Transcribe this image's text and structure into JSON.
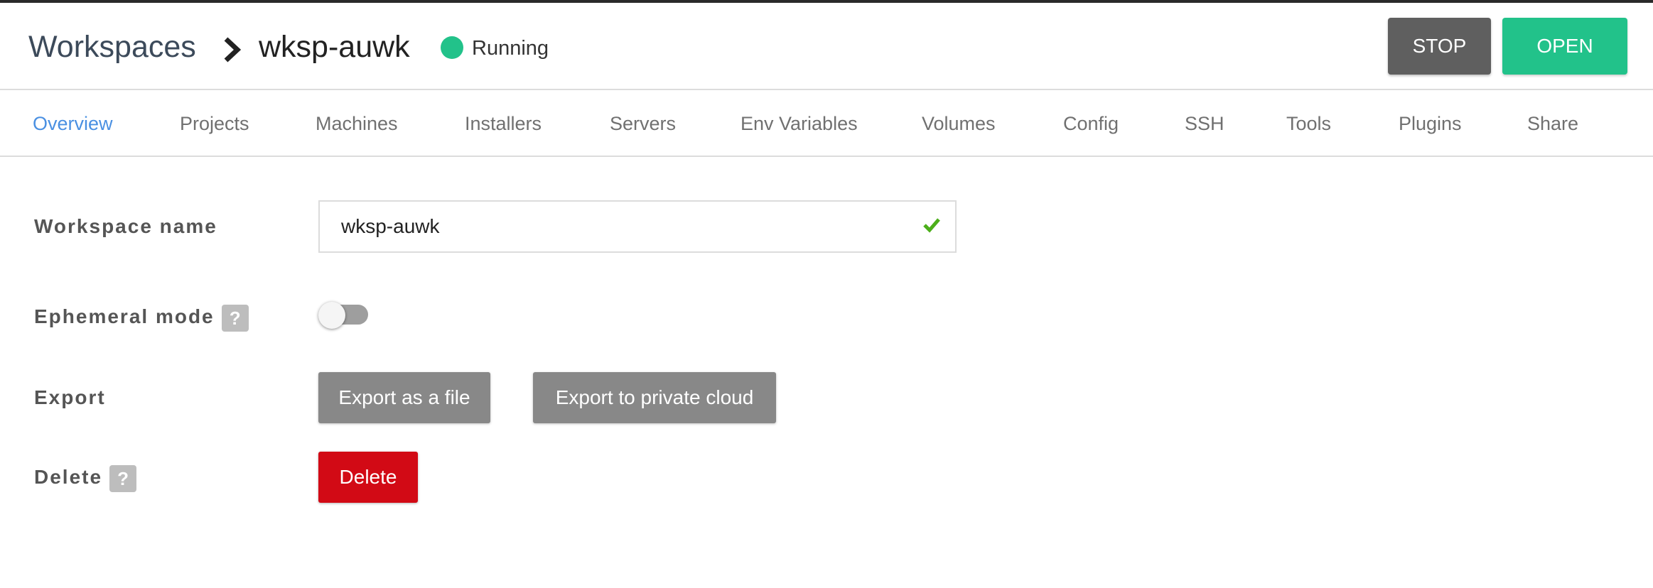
{
  "header": {
    "breadcrumb_root": "Workspaces",
    "workspace_name": "wksp-auwk",
    "status": "Running",
    "status_color": "#22c28a",
    "stop_label": "STOP",
    "open_label": "OPEN"
  },
  "tabs": [
    {
      "label": "Overview",
      "active": true
    },
    {
      "label": "Projects"
    },
    {
      "label": "Machines"
    },
    {
      "label": "Installers"
    },
    {
      "label": "Servers"
    },
    {
      "label": "Env Variables"
    },
    {
      "label": "Volumes"
    },
    {
      "label": "Config"
    },
    {
      "label": "SSH"
    },
    {
      "label": "Tools"
    },
    {
      "label": "Plugins"
    },
    {
      "label": "Share"
    }
  ],
  "form": {
    "name_label": "Workspace name",
    "name_value": "wksp-auwk",
    "ephemeral_label": "Ephemeral mode",
    "ephemeral_enabled": false,
    "export_label": "Export",
    "export_file_label": "Export as a file",
    "export_cloud_label": "Export to private cloud",
    "delete_label": "Delete",
    "delete_button_label": "Delete",
    "help_glyph": "?"
  },
  "colors": {
    "accent": "#4a90e2",
    "success": "#22c28a",
    "danger": "#d20a15"
  }
}
